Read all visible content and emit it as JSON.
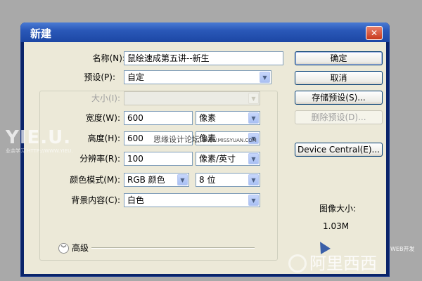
{
  "window": {
    "title": "新建",
    "close_glyph": "✕"
  },
  "form": {
    "name": {
      "label": "名称(N):",
      "value": "鼠绘速成第五讲--新生"
    },
    "preset": {
      "label": "预设(P):",
      "value": "自定"
    },
    "size": {
      "label": "大小(I):",
      "value": ""
    },
    "width": {
      "label": "宽度(W):",
      "value": "600",
      "unit": "像素"
    },
    "height": {
      "label": "高度(H):",
      "value": "600",
      "unit": "像素"
    },
    "resolution": {
      "label": "分辨率(R):",
      "value": "100",
      "unit": "像素/英寸"
    },
    "color_mode": {
      "label": "颜色模式(M):",
      "value": "RGB 颜色",
      "depth": "8 位"
    },
    "background": {
      "label": "背景内容(C):",
      "value": "白色"
    },
    "advanced": {
      "label": "高级",
      "icon": "chevron-double-down-icon"
    }
  },
  "buttons": {
    "ok": "确定",
    "cancel": "取消",
    "save_preset": "存储预设(S)...",
    "delete_preset": "删除预设(D)...",
    "device_central": "Device Central(E)..."
  },
  "image_size": {
    "label": "图像大小:",
    "value": "1.03M"
  },
  "watermarks": {
    "left_logo": "YIE.U.",
    "left_logo_sub": "业余学习 HTTP://WWW.YIEU.",
    "center_text": "思缘设计论坛",
    "center_url": "WWW.MISSYUAN.COM",
    "bottom_text": "阿里西西",
    "bottom_sub": "WEB开发"
  },
  "colors": {
    "title_bar": "#2a58b8",
    "dialog_bg": "#ece9d8",
    "page_bg": "#a9a9a9"
  }
}
